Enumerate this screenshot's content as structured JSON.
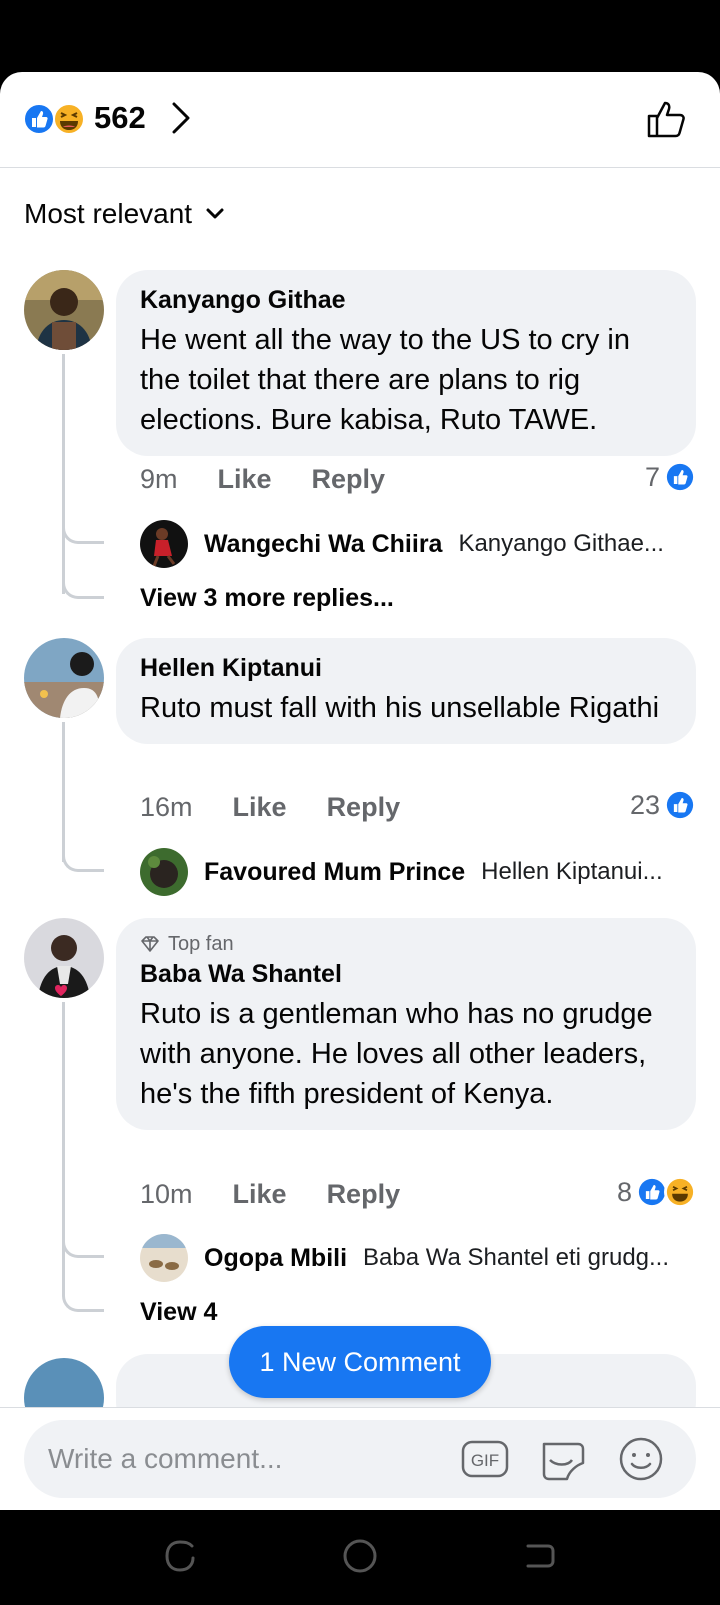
{
  "header": {
    "reaction_count": "562"
  },
  "sort": {
    "label": "Most relevant"
  },
  "comments": [
    {
      "author": "Kanyango Githae",
      "text": "He went all the way to the US to cry in the toilet that there are plans to rig elections. Bure kabisa, Ruto TAWE.",
      "time": "9m",
      "like": "Like",
      "reply": "Reply",
      "reactions": "7",
      "reply_preview": {
        "author": "Wangechi Wa Chiira",
        "text": "Kanyango Githae..."
      },
      "more_replies": "View 3 more replies..."
    },
    {
      "author": "Hellen Kiptanui",
      "text": "Ruto must fall with his unsellable Rigathi",
      "time": "16m",
      "like": "Like",
      "reply": "Reply",
      "reactions": "23",
      "reply_preview": {
        "author": "Favoured Mum Prince",
        "text": "Hellen Kiptanui..."
      }
    },
    {
      "badge": "Top fan",
      "author": "Baba Wa Shantel",
      "text": "Ruto is a gentleman who has no grudge with anyone. He loves all other leaders, he's the fifth president of Kenya.",
      "time": "10m",
      "like": "Like",
      "reply": "Reply",
      "reactions": "8",
      "reply_preview": {
        "author": "Ogopa Mbili",
        "text": "Baba Wa Shantel eti grudg..."
      },
      "more_replies": "View 4"
    }
  ],
  "new_comment_button": "1 New Comment",
  "composer": {
    "placeholder": "Write a comment...",
    "gif_label": "GIF"
  },
  "colors": {
    "accent": "#1877f2",
    "like": "#1877f2",
    "haha": "#f7b125"
  },
  "icons": [
    "like-reaction-icon",
    "haha-reaction-icon",
    "chevron-right-icon",
    "thumbs-up-outline-icon",
    "chevron-down-icon",
    "diamond-icon",
    "gif-icon",
    "sticker-icon",
    "emoji-icon",
    "recents-icon",
    "home-icon",
    "back-icon"
  ]
}
